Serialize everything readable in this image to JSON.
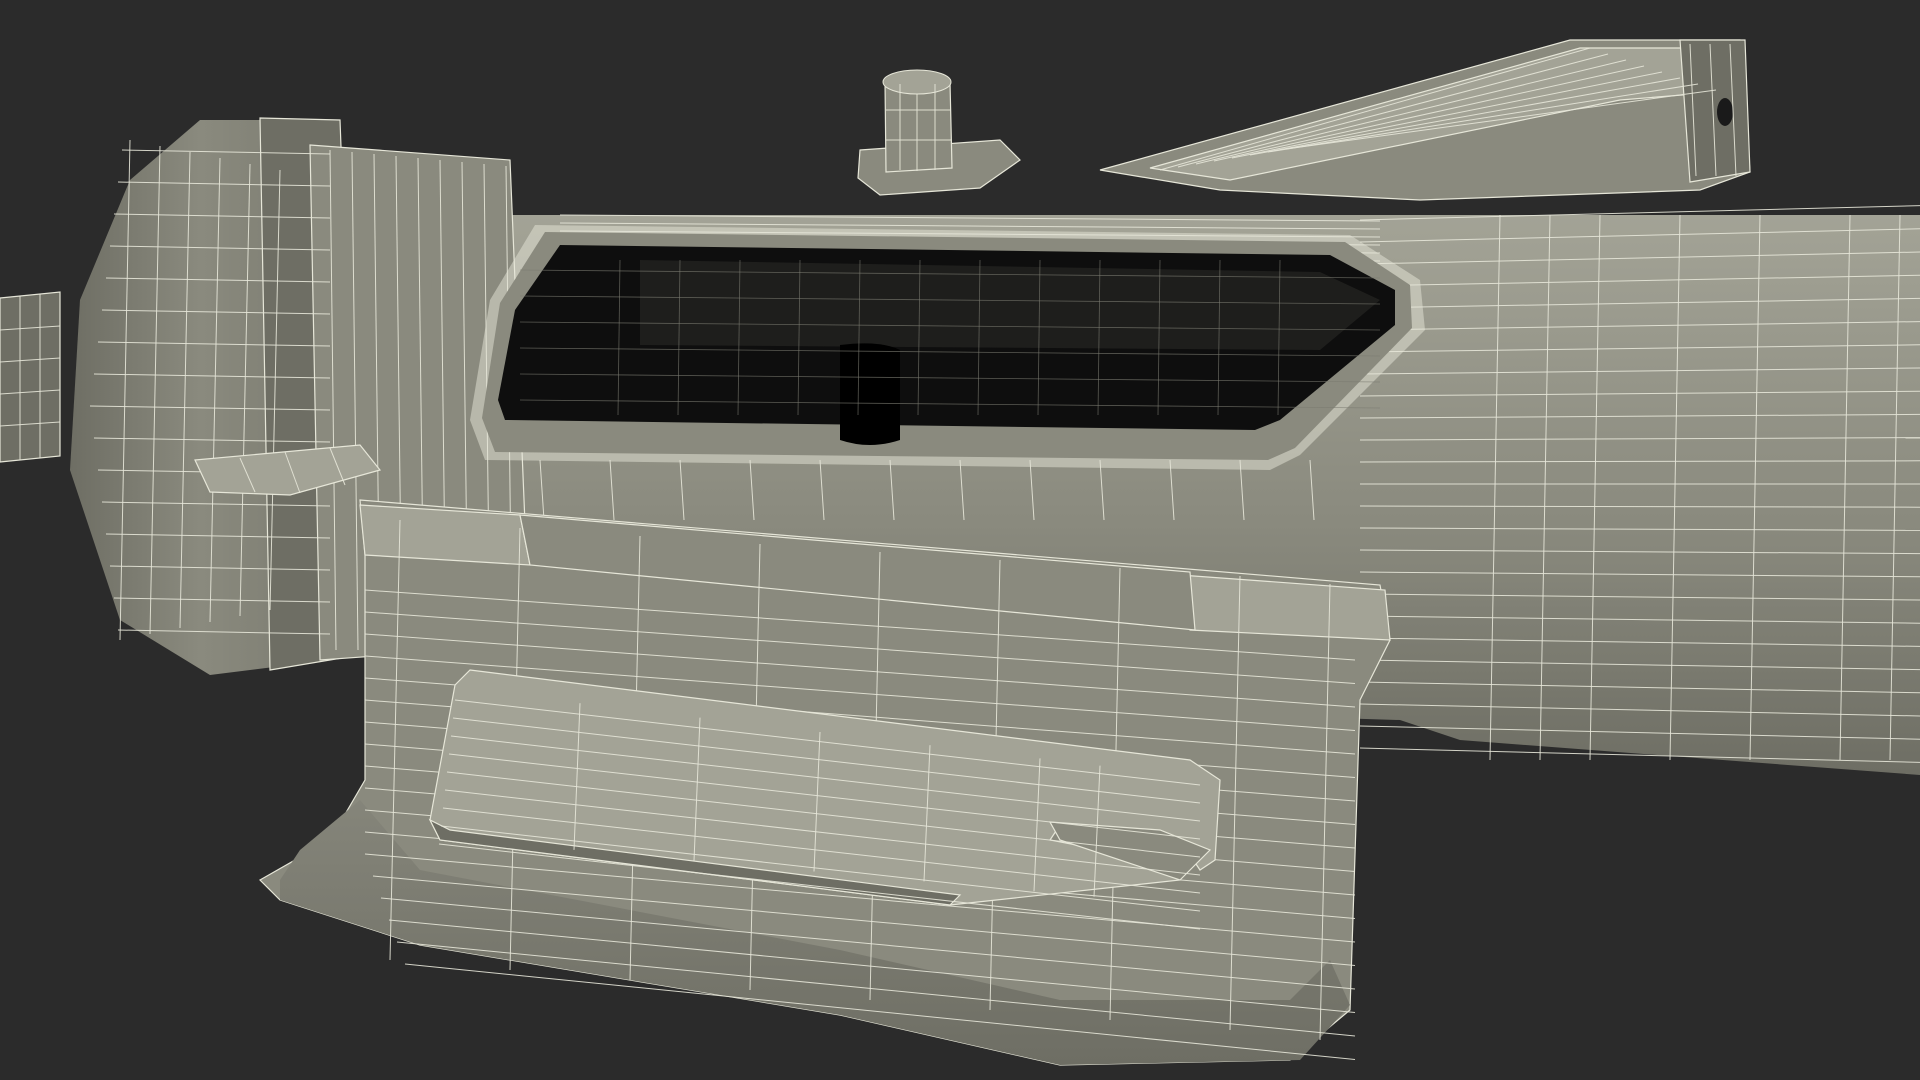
{
  "scene": {
    "background_color": "#2b2b2b",
    "model_fill_color": "#8a8a7e",
    "model_shade_color": "#6e6e64",
    "model_highlight_color": "#a3a396",
    "wire_color": "#e6e6d8",
    "cavity_color": "#0e0e0e",
    "render_style": "wireframe-over-shaded"
  }
}
